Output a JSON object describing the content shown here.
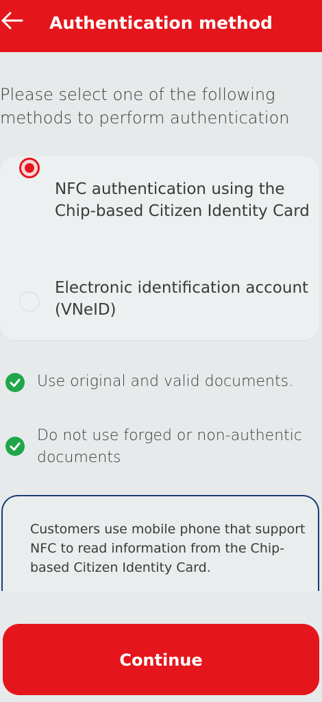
{
  "header": {
    "title": "Authentication method",
    "back_icon": "arrow-left-icon"
  },
  "instruction": "Please select one of the following methods to perform authentication",
  "options": [
    {
      "label": "NFC authentication using the Chip-based Citizen Identity Card",
      "selected": true
    },
    {
      "label": "Electronic identification account (VNeID)",
      "selected": false
    }
  ],
  "notes": [
    {
      "icon": "check-circle-icon",
      "text": "Use original and valid documents."
    },
    {
      "icon": "check-circle-icon",
      "text": "Do not use forged or non-authentic documents"
    }
  ],
  "info": {
    "text": "Customers use mobile phone that support NFC to read information from the Chip-based Citizen Identity Card."
  },
  "continue_button": {
    "label": "Continue"
  },
  "colors": {
    "primary": "#e4161c",
    "success": "#1fa64a",
    "info_border": "#1b3a7a",
    "background": "#e6eaea"
  }
}
